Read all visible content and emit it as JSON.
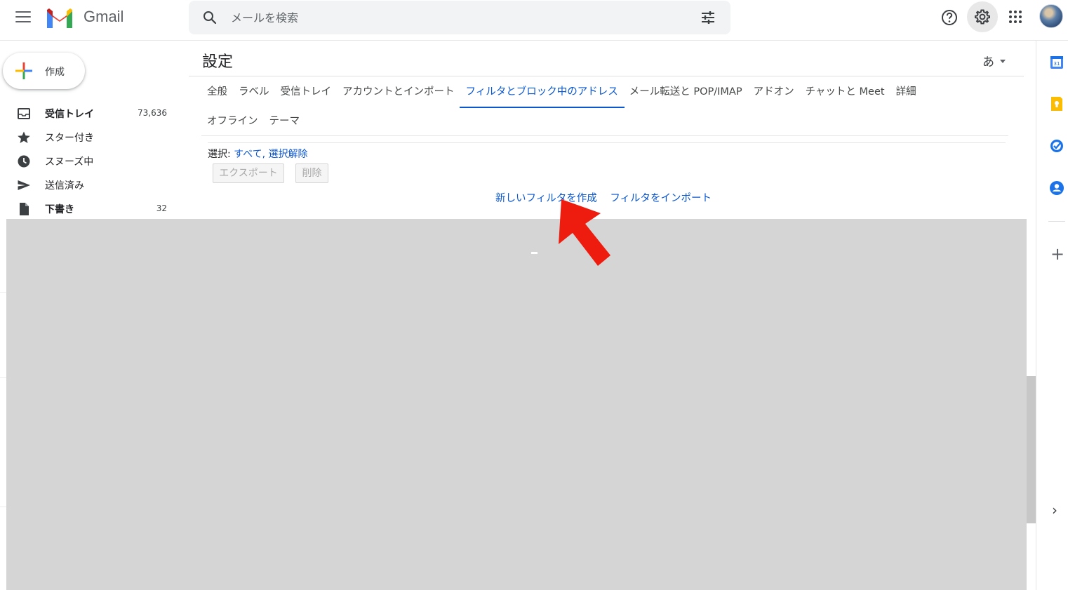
{
  "header": {
    "app_name": "Gmail",
    "search_placeholder": "メールを検索"
  },
  "sidebar": {
    "compose_label": "作成",
    "items": [
      {
        "label": "受信トレイ",
        "count": "73,636"
      },
      {
        "label": "スター付き",
        "count": ""
      },
      {
        "label": "スヌーズ中",
        "count": ""
      },
      {
        "label": "送信済み",
        "count": ""
      },
      {
        "label": "下書き",
        "count": "32"
      }
    ]
  },
  "settings": {
    "title": "設定",
    "lang_selector": "あ",
    "tabs_row1": [
      "全般",
      "ラベル",
      "受信トレイ",
      "アカウントとインポート",
      "フィルタとブロック中のアドレス",
      "メール転送と POP/IMAP",
      "アドオン",
      "チャットと Meet",
      "詳細"
    ],
    "tabs_row2": [
      "オフライン",
      "テーマ"
    ],
    "active_tab": "フィルタとブロック中のアドレス",
    "select_label": "選択:",
    "select_all": "すべて",
    "select_separator": ",",
    "select_none": "選択解除",
    "export_button": "エクスポート",
    "delete_button": "削除",
    "create_filter_link": "新しいフィルタを作成",
    "import_filter_link": "フィルタをインポート"
  },
  "colors": {
    "accent": "#0b57d0",
    "overlay": "#d6d5d5",
    "arrow": "#ee1c0e"
  },
  "icons": [
    "menu-icon",
    "gmail-logo",
    "search-icon",
    "tune-icon",
    "help-icon",
    "gear-icon",
    "apps-icon",
    "calendar-icon",
    "keep-icon",
    "tasks-icon",
    "contacts-icon",
    "add-icon",
    "chevron-right-icon"
  ]
}
